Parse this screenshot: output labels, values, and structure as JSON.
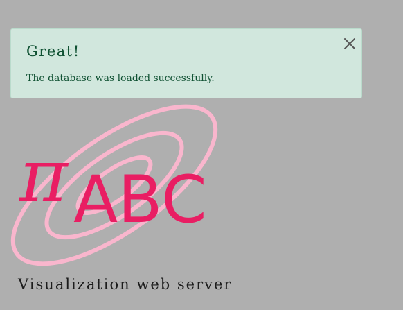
{
  "alert": {
    "title": "Great!",
    "message": "The database was loaded successfully.",
    "close_icon": "close-icon",
    "colors": {
      "background": "#d1e7dd",
      "text": "#0f5132"
    }
  },
  "logo": {
    "pi_glyph": "π",
    "letters": "ABC",
    "colors": {
      "glyph": "#e91e63",
      "rings": "#f9b6cd"
    }
  },
  "tagline": "Visualization web server",
  "page": {
    "background": "#afafaf"
  }
}
